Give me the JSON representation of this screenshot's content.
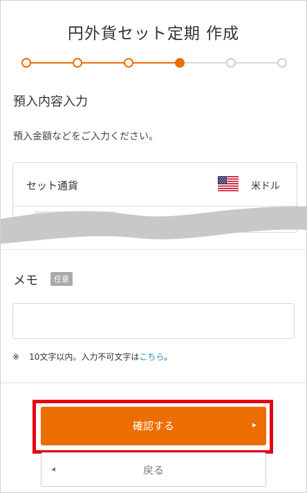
{
  "header": {
    "title": "円外貨セット定期 作成"
  },
  "stepper": {
    "total_steps": 6,
    "current_step": 4,
    "done_color": "#ec6d00",
    "todo_color": "#d0d0d0"
  },
  "section": {
    "heading": "預入内容入力",
    "lead": "預入金額などをご入力ください。"
  },
  "currency": {
    "label": "セット通貨",
    "flag_icon": "us-flag-icon",
    "value": "米ドル"
  },
  "memo": {
    "label": "メモ",
    "badge": "任意",
    "value": "",
    "note_mark": "※",
    "note_text": "10文字以内。入力不可文字は",
    "note_link": "こちら",
    "note_end": "。"
  },
  "actions": {
    "confirm_label": "確認する",
    "confirm_arrow": "▸",
    "back_label": "戻る",
    "back_arrow": "◂",
    "accent": "#ec6d00",
    "highlight": "#e60012"
  }
}
